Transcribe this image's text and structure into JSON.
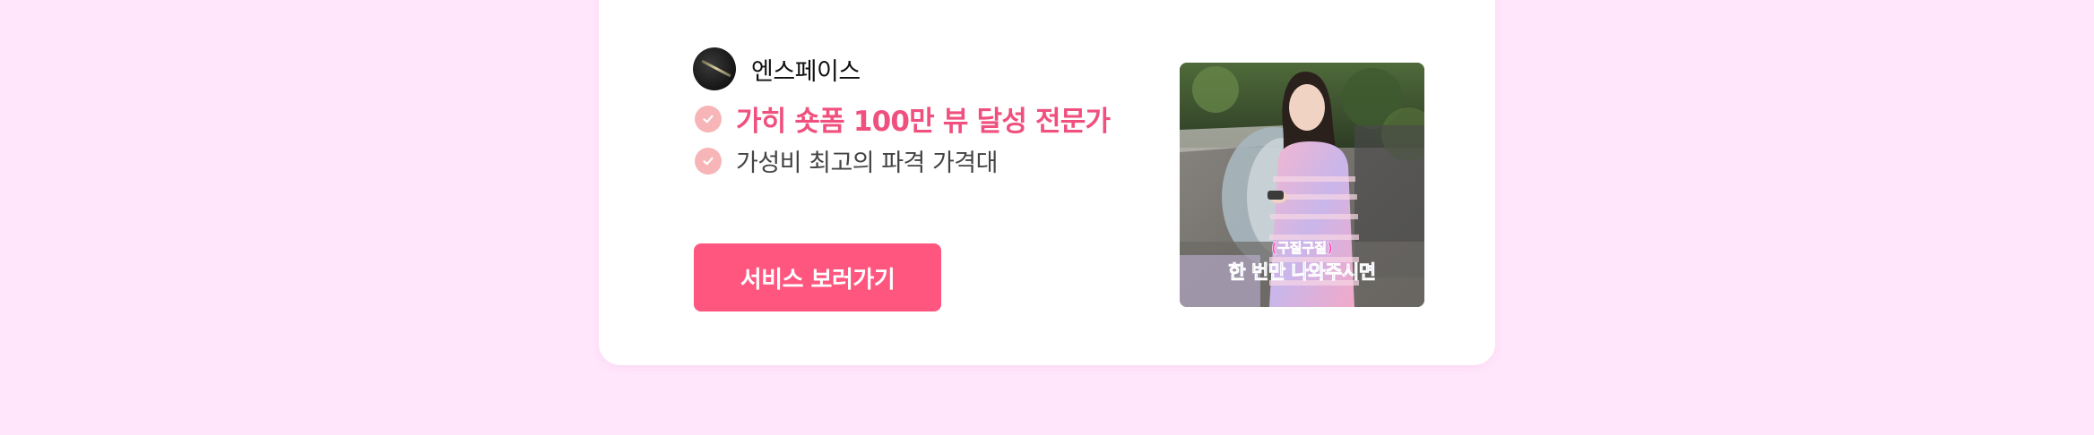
{
  "brand": {
    "name": "엔스페이스"
  },
  "features": [
    {
      "text": "가히 숏폼 100만 뷰 달성 전문가"
    },
    {
      "text": "가성비 최고의 파격 가격대"
    }
  ],
  "cta": {
    "label": "서비스 보러가기"
  },
  "thumbnail": {
    "caption_top": "(구질구질)",
    "caption_main": "한 번만 나와주시면"
  },
  "colors": {
    "background": "#ffe6fb",
    "accent": "#f0507e",
    "button": "#ff5680",
    "check": "#f7b5b7"
  }
}
